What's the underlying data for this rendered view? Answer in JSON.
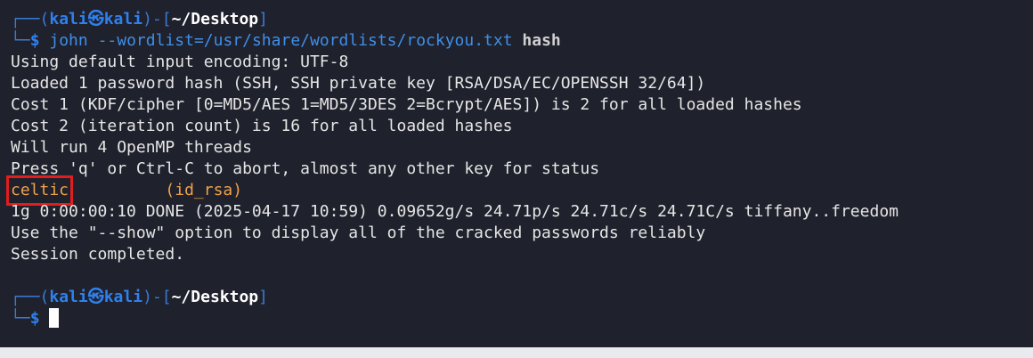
{
  "terminal": {
    "prompt1": {
      "corner_top": "┌──(",
      "user": "kali",
      "at_symbol": "㉿",
      "host": "kali",
      "mid": ")-[",
      "path": "~/Desktop",
      "end": "]",
      "corner_bottom": "└─",
      "dollar": "$"
    },
    "command": {
      "program": "john",
      "option": "--wordlist=/usr/share/wordlists/rockyou.txt",
      "target": "hash"
    },
    "output": [
      "Using default input encoding: UTF-8",
      "Loaded 1 password hash (SSH, SSH private key [RSA/DSA/EC/OPENSSH 32/64])",
      "Cost 1 (KDF/cipher [0=MD5/AES 1=MD5/3DES 2=Bcrypt/AES]) is 2 for all loaded hashes",
      "Cost 2 (iteration count) is 16 for all loaded hashes",
      "Will run 4 OpenMP threads",
      "Press 'q' or Ctrl-C to abort, almost any other key for status"
    ],
    "cracked": {
      "password": "celtic",
      "spacer": "          ",
      "file": "(id_rsa)"
    },
    "output_after": [
      "1g 0:00:00:10 DONE (2025-04-17 10:59) 0.09652g/s 24.71p/s 24.71c/s 24.71C/s tiffany..freedom",
      "Use the \"--show\" option to display all of the cracked passwords reliably",
      "Session completed."
    ],
    "prompt2": {
      "corner_top": "┌──(",
      "user": "kali",
      "at_symbol": "㉿",
      "host": "kali",
      "mid": ")-[",
      "path": "~/Desktop",
      "end": "]",
      "corner_bottom": "└─",
      "dollar": "$"
    }
  }
}
